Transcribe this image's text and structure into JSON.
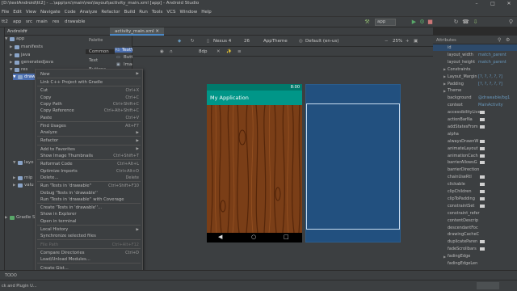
{
  "window": {
    "title": "[D:\\testAndroid\\tt2] - ...\\app\\src\\main\\res\\layout\\activity_main.xml [app] - Android Studio"
  },
  "menu": [
    "File",
    "Edit",
    "View",
    "Navigate",
    "Code",
    "Analyze",
    "Refactor",
    "Build",
    "Run",
    "Tools",
    "VCS",
    "Window",
    "Help"
  ],
  "breadcrumb": [
    "tt2",
    "app",
    "src",
    "main",
    "res",
    "drawable"
  ],
  "toolbar": {
    "run_config": "app",
    "api_level": "26",
    "device": "Nexus 4",
    "theme": "AppTheme",
    "locale": "Default (en-us)",
    "zoom": "25%"
  },
  "editor": {
    "tab_label": "activity_main.xml"
  },
  "project": {
    "view_mode": "Android"
  },
  "tree": [
    {
      "label": "app"
    },
    {
      "label": "manifests"
    },
    {
      "label": "java"
    },
    {
      "label": "generatedJava"
    },
    {
      "label": "res"
    },
    {
      "label": "draw"
    },
    {
      "label": "layo"
    },
    {
      "label": "mip"
    },
    {
      "label": "valu"
    },
    {
      "label": "Gradle Scri"
    }
  ],
  "palette": {
    "header": "Palette",
    "categories": [
      "Common",
      "Text",
      "Buttons"
    ],
    "items": [
      "TextView",
      "Button",
      "ImageView"
    ]
  },
  "design": {
    "dp_value": "8dp"
  },
  "preview": {
    "app_title": "My Application",
    "time": "8:00"
  },
  "attributes": {
    "header": "Attributes",
    "rows": [
      {
        "k": "id",
        "v": ""
      },
      {
        "k": "layout_width",
        "v": "match_parent"
      },
      {
        "k": "layout_height",
        "v": "match_parent"
      },
      {
        "k": "Constraints",
        "v": ""
      },
      {
        "k": "Layout_Margin",
        "v": "[?, ?, ?, ?, ?]"
      },
      {
        "k": "Padding",
        "v": "[?, ?, ?, ?, ?]"
      },
      {
        "k": "Theme",
        "v": ""
      },
      {
        "k": "background",
        "v": "@drawable/bg1"
      },
      {
        "k": "context",
        "v": "MainActivity"
      },
      {
        "k": "accessibilityLive",
        "v": ""
      },
      {
        "k": "actionBarNa",
        "v": ""
      },
      {
        "k": "addStatesFrom",
        "v": ""
      },
      {
        "k": "alpha",
        "v": ""
      },
      {
        "k": "alwaysDrawnW",
        "v": ""
      },
      {
        "k": "animateLayout",
        "v": ""
      },
      {
        "k": "animationCach",
        "v": ""
      },
      {
        "k": "barrierAllowsG",
        "v": ""
      },
      {
        "k": "barrierDirection",
        "v": ""
      },
      {
        "k": "chainUseRtl",
        "v": ""
      },
      {
        "k": "clickable",
        "v": ""
      },
      {
        "k": "clipChildren",
        "v": ""
      },
      {
        "k": "clipToPadding",
        "v": ""
      },
      {
        "k": "constraintSet",
        "v": ""
      },
      {
        "k": "constraint_refer",
        "v": ""
      },
      {
        "k": "contentDescrip",
        "v": ""
      },
      {
        "k": "descendantFoc",
        "v": ""
      },
      {
        "k": "drawingCacheC",
        "v": ""
      },
      {
        "k": "duplicateParen",
        "v": ""
      },
      {
        "k": "fadeScrollbars",
        "v": ""
      },
      {
        "k": "fadingEdge",
        "v": ""
      },
      {
        "k": "fadingEdgeLen",
        "v": ""
      }
    ]
  },
  "context_menu": [
    {
      "label": "New",
      "shortcut": "",
      "sub": true,
      "disabled": false
    },
    {
      "sep": true
    },
    {
      "label": "Link C++ Project with Gradle",
      "shortcut": "",
      "sub": false,
      "disabled": false
    },
    {
      "sep": true
    },
    {
      "label": "Cut",
      "shortcut": "Ctrl+X",
      "sub": false,
      "disabled": false
    },
    {
      "label": "Copy",
      "shortcut": "Ctrl+C",
      "sub": false,
      "disabled": false
    },
    {
      "label": "Copy Path",
      "shortcut": "Ctrl+Shift+C",
      "sub": false,
      "disabled": false
    },
    {
      "label": "Copy Reference",
      "shortcut": "Ctrl+Alt+Shift+C",
      "sub": false,
      "disabled": false
    },
    {
      "label": "Paste",
      "shortcut": "Ctrl+V",
      "sub": false,
      "disabled": false
    },
    {
      "sep": true
    },
    {
      "label": "Find Usages",
      "shortcut": "Alt+F7",
      "sub": false,
      "disabled": false
    },
    {
      "label": "Analyze",
      "shortcut": "",
      "sub": true,
      "disabled": false
    },
    {
      "sep": true
    },
    {
      "label": "Refactor",
      "shortcut": "",
      "sub": true,
      "disabled": false
    },
    {
      "sep": true
    },
    {
      "label": "Add to Favorites",
      "shortcut": "",
      "sub": true,
      "disabled": false
    },
    {
      "label": "Show Image Thumbnails",
      "shortcut": "Ctrl+Shift+T",
      "sub": false,
      "disabled": false
    },
    {
      "sep": true
    },
    {
      "label": "Reformat Code",
      "shortcut": "Ctrl+Alt+L",
      "sub": false,
      "disabled": false
    },
    {
      "label": "Optimize Imports",
      "shortcut": "Ctrl+Alt+O",
      "sub": false,
      "disabled": false
    },
    {
      "label": "Delete...",
      "shortcut": "Delete",
      "sub": false,
      "disabled": false
    },
    {
      "sep": true
    },
    {
      "label": "Run 'Tests in 'drawable''",
      "shortcut": "Ctrl+Shift+F10",
      "sub": false,
      "disabled": false
    },
    {
      "label": "Debug 'Tests in 'drawable''",
      "shortcut": "",
      "sub": false,
      "disabled": false
    },
    {
      "label": "Run 'Tests in 'drawable'' with Coverage",
      "shortcut": "",
      "sub": false,
      "disabled": false
    },
    {
      "sep": true
    },
    {
      "label": "Create 'Tests in 'drawable''...",
      "shortcut": "",
      "sub": false,
      "disabled": false
    },
    {
      "label": "Show in Explorer",
      "shortcut": "",
      "sub": false,
      "disabled": false
    },
    {
      "label": "Open in terminal",
      "shortcut": "",
      "sub": false,
      "disabled": false
    },
    {
      "sep": true
    },
    {
      "label": "Local History",
      "shortcut": "",
      "sub": true,
      "disabled": false
    },
    {
      "label": "Synchronize selected files",
      "shortcut": "",
      "sub": false,
      "disabled": false
    },
    {
      "sep": true
    },
    {
      "label": "File Path",
      "shortcut": "Ctrl+Alt+F12",
      "sub": false,
      "disabled": true
    },
    {
      "sep": true
    },
    {
      "label": "Compare Directories",
      "shortcut": "Ctrl+D",
      "sub": false,
      "disabled": false
    },
    {
      "label": "Load/Unload Modules...",
      "shortcut": "",
      "sub": false,
      "disabled": false
    },
    {
      "sep": true
    },
    {
      "label": "Create Gist...",
      "shortcut": "",
      "sub": false,
      "disabled": false
    }
  ],
  "bottom": {
    "todo": "TODO",
    "logcat": "ck and Plugin U..."
  },
  "colors": {
    "accent": "#4b6eaf",
    "app_bar": "#009688",
    "status_bar": "#00796b",
    "blueprint": "#22507f",
    "wood": "#7a3e17"
  }
}
